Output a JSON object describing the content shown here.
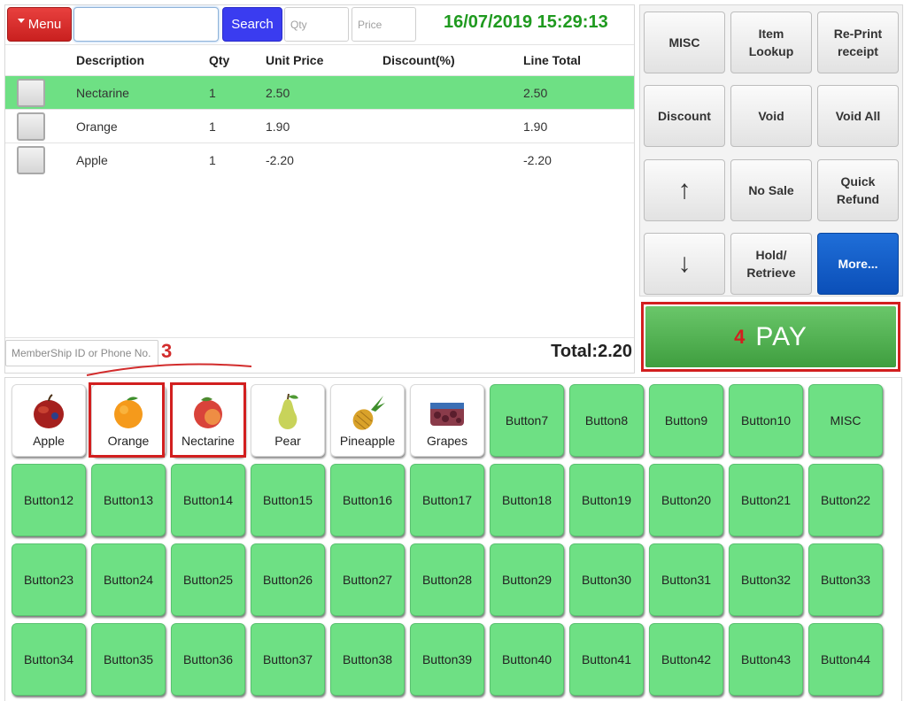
{
  "header": {
    "menu_label": "Menu",
    "search_placeholder": "",
    "search_label": "Search",
    "qty_placeholder": "Qty",
    "price_placeholder": "Price",
    "datetime": "16/07/2019 15:29:13"
  },
  "order": {
    "columns": {
      "description": "Description",
      "qty": "Qty",
      "unit_price": "Unit Price",
      "discount": "Discount(%)",
      "line_total": "Line Total"
    },
    "rows": [
      {
        "description": "Nectarine",
        "qty": "1",
        "unit_price": "2.50",
        "discount": "",
        "line_total": "2.50"
      },
      {
        "description": "Orange",
        "qty": "1",
        "unit_price": "1.90",
        "discount": "",
        "line_total": "1.90"
      },
      {
        "description": "Apple",
        "qty": "1",
        "unit_price": "-2.20",
        "discount": "",
        "line_total": "-2.20"
      }
    ],
    "member_placeholder": "MemberShip ID or Phone No.",
    "total": "Total:2.20"
  },
  "annotations": {
    "step3": "3",
    "step4": "4"
  },
  "functions": {
    "misc": "MISC",
    "item_lookup": "Item\nLookup",
    "reprint": "Re-Print\nreceipt",
    "discount": "Discount",
    "void": "Void",
    "void_all": "Void All",
    "up": "↑",
    "no_sale": "No Sale",
    "quick_refund": "Quick\nRefund",
    "down": "↓",
    "hold": "Hold/\nRetrieve",
    "more": "More..."
  },
  "pay_label": "PAY",
  "products": [
    "Apple",
    "Orange",
    "Nectarine",
    "Pear",
    "Pineapple",
    "Grapes"
  ],
  "buttons_row1": [
    "Button7",
    "Button8",
    "Button9",
    "Button10",
    "MISC"
  ],
  "buttons_row2": [
    "Button12",
    "Button13",
    "Button14",
    "Button15",
    "Button16",
    "Button17",
    "Button18",
    "Button19",
    "Button20",
    "Button21",
    "Button22"
  ],
  "buttons_row3": [
    "Button23",
    "Button24",
    "Button25",
    "Button26",
    "Button27",
    "Button28",
    "Button29",
    "Button30",
    "Button31",
    "Button32",
    "Button33"
  ],
  "buttons_row4": [
    "Button34",
    "Button35",
    "Button36",
    "Button37",
    "Button38",
    "Button39",
    "Button40",
    "Button41",
    "Button42",
    "Button43",
    "Button44"
  ],
  "colors": {
    "accent_green": "#6ee084",
    "pay_green": "#4fae4f",
    "menu_red": "#d82f2e",
    "search_blue": "#3a3cf0",
    "more_blue": "#1360c8",
    "highlight_red": "#d21f1f"
  }
}
